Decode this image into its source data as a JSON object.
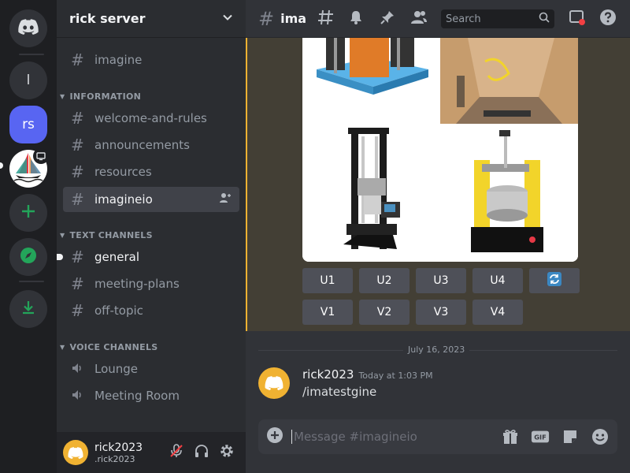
{
  "rail": {
    "servers": [
      {
        "label": "l"
      },
      {
        "label": "rs"
      }
    ]
  },
  "server": {
    "name": "rick server"
  },
  "channels": {
    "top": "imagine",
    "categories": [
      {
        "name": "INFORMATION",
        "items": [
          "welcome-and-rules",
          "announcements",
          "resources",
          "imagineio"
        ]
      },
      {
        "name": "TEXT CHANNELS",
        "items": [
          "general",
          "meeting-plans",
          "off-topic"
        ]
      },
      {
        "name": "VOICE CHANNELS",
        "items": [
          "Lounge",
          "Meeting Room"
        ]
      }
    ]
  },
  "user": {
    "name": "rick2023",
    "tag": ".rick2023"
  },
  "topbar": {
    "title": "imagineio",
    "search_placeholder": "Search"
  },
  "job": {
    "upscale_buttons": [
      "U1",
      "U2",
      "U3",
      "U4"
    ],
    "variation_buttons": [
      "V1",
      "V2",
      "V3",
      "V4"
    ]
  },
  "messages": {
    "date": "July 16, 2023",
    "author": "rick2023",
    "time": "Today at 1:03 PM",
    "body": "/imatestgine"
  },
  "composer": {
    "placeholder": "Message #imagineio"
  },
  "colors": {
    "brand": "#5865f2",
    "accent_yellow": "#f0b232",
    "green": "#23a55a"
  }
}
